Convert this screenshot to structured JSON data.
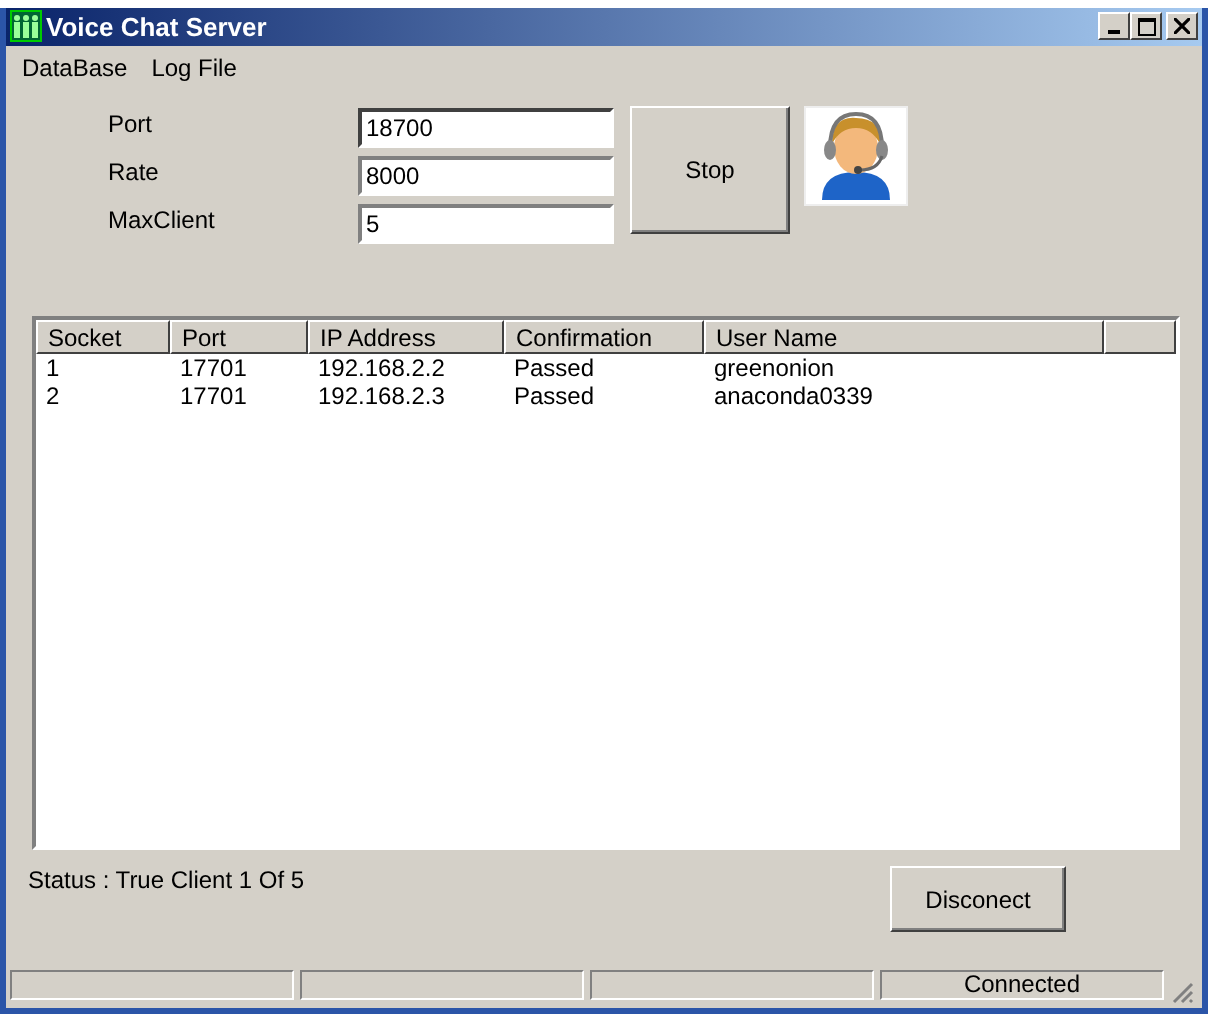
{
  "window": {
    "title": "Voice Chat Server"
  },
  "menu": [
    "DataBase",
    "Log File"
  ],
  "fields": [
    {
      "label": "Port",
      "value": "18700",
      "focused": true
    },
    {
      "label": "Rate",
      "value": "8000",
      "focused": false
    },
    {
      "label": "MaxClient",
      "value": "5",
      "focused": false
    }
  ],
  "stop_button": "Stop",
  "table": {
    "columns": [
      "Socket",
      "Port",
      "IP Address",
      "Confirmation",
      "User Name"
    ],
    "rows": [
      [
        "1",
        "17701",
        "192.168.2.2",
        "Passed",
        "greenonion"
      ],
      [
        "2",
        "17701",
        "192.168.2.3",
        "Passed",
        "anaconda0339"
      ]
    ]
  },
  "status": "Status : True Client 1 Of 5",
  "disconnect_button": "Disconect",
  "status_bar": [
    {
      "kind": "empty"
    },
    {
      "kind": "empty"
    },
    {
      "kind": "empty"
    },
    {
      "kind": "text",
      "text": "Connected"
    }
  ]
}
